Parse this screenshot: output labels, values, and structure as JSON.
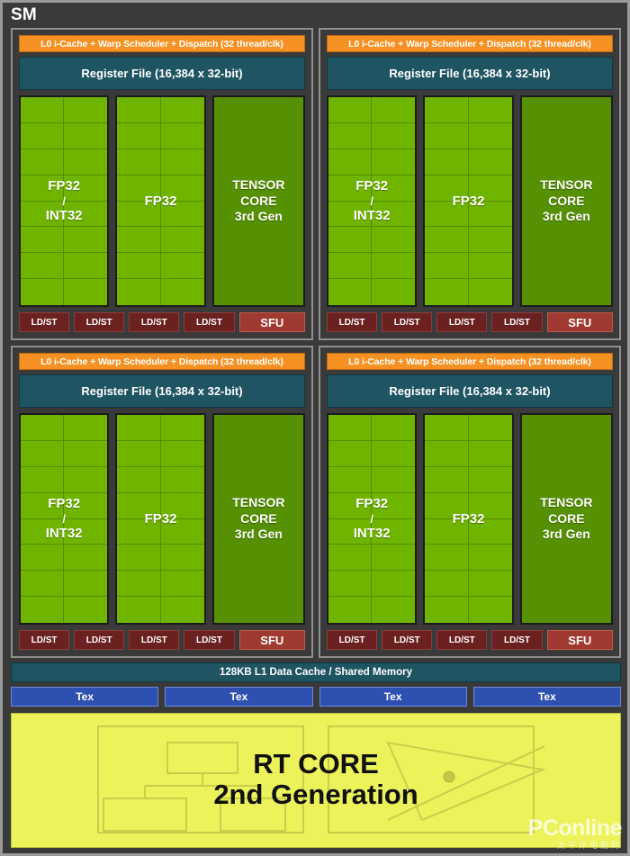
{
  "diagram": {
    "title": "SM",
    "subtitle_note": ""
  },
  "partition": {
    "scheduler_label": "L0 i-Cache + Warp Scheduler + Dispatch (32 thread/clk)",
    "register_file_label": "Register File (16,384 x 32-bit)",
    "fp32_int32_label_line1": "FP32",
    "fp32_int32_label_slash": "/",
    "fp32_int32_label_line2": "INT32",
    "fp32_label": "FP32",
    "tensor_label_line1": "TENSOR",
    "tensor_label_line2": "CORE",
    "tensor_label_line3": "3rd Gen",
    "ldst_label": "LD/ST",
    "sfu_label": "SFU",
    "ldst_count": 4,
    "fp32_cell_rows": 8,
    "fp32_cell_cols": 2
  },
  "shared": {
    "l1_cache_label": "128KB L1 Data Cache / Shared Memory",
    "tex_label": "Tex",
    "tex_count": 4
  },
  "rt_core": {
    "line1": "RT CORE",
    "line2": "2nd Generation"
  },
  "watermark": {
    "main": "PConline",
    "sub": "太平洋电脑网"
  },
  "colors": {
    "background": "#3a3a3a",
    "scheduler_orange": "#f59122",
    "register_teal": "#1f5462",
    "fp32_green": "#6fb500",
    "tensor_green": "#559103",
    "ldst_red": "#6b2120",
    "sfu_red": "#a03a30",
    "tex_blue": "#2e50b0",
    "rt_yellow": "#ecf25a"
  }
}
